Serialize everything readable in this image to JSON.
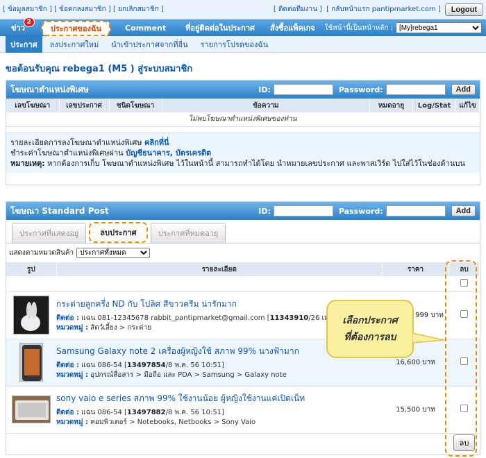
{
  "topbar": {
    "links": [
      "[ ข้อมูลสมาชิก ]",
      "[ ข้อตกลงสมาชิก ]",
      "[ ยกเลิกสมาชิก ]"
    ],
    "contact": "[ ติดต่อทีมงาน ]",
    "home": "[ กลับหน้าแรก pantipmarket.com ]",
    "logout": "Logout"
  },
  "nav": {
    "items": [
      {
        "label": "ข่าว",
        "badge": "2"
      },
      {
        "label": "ประกาศของฉัน"
      },
      {
        "label": "Comment"
      },
      {
        "label": "ที่อยู่ติดต่อในประกาศ"
      },
      {
        "label": "สั่งซื้อแพ็คเกจ"
      }
    ],
    "home_label": "ใช้หน้านี้เป็นหน้าหลัก :",
    "home_select": "[My]rebega1"
  },
  "subnav": [
    "ประกาศ",
    "ลงประกาศใหม่",
    "นำเข้าประกาศจากที่อื่น",
    "รายการโปรดของฉัน"
  ],
  "welcome": "ขอต้อนรับคุณ rebega1     (M5       ) สู่ระบบสมาชิก",
  "special": {
    "title": "โฆษณาตำแหน่งพิเศษ",
    "id_label": "ID:",
    "pw_label": "Password:",
    "add": "Add",
    "headers": [
      "เลขโฆษณา",
      "เลขประกาศ",
      "ชนิดโฆษณา",
      "ข้อความ",
      "หมดอายุ",
      "Log/Stat",
      "แก้ไข"
    ],
    "empty": "ไม่พบโฆษณาตำแหน่งพิเศษของท่าน",
    "info1_text": "รายละเอียดการลงโฆษณาตำแหน่งพิเศษ ",
    "info1_link": "คลิกที่นี่",
    "info2_text": "ชำระค่าโฆษณาตำแหน่งพิเศษผ่าน ",
    "info2_link": "บัญชีธนาคาร, บัตรเครดิต",
    "info3_label": "หมายเหตุ:",
    "info3_text": " หากต้องการเก็บ โฆษณาตำแหน่งพิเศษ ไว้ในหน้านี้ สามารถทำได้โดย นำหมายเลขประกาศ และพาสเวิร์ด ไปใส่ไว้ในช่องด้านบน"
  },
  "standard": {
    "title": "โฆษณา Standard Post",
    "id_label": "ID:",
    "pw_label": "Password:",
    "add": "Add",
    "tabs": [
      "ประกาศที่แสดงอยู่",
      "ลบประกาศ",
      "ประกาศที่หมดอายุ"
    ],
    "filter_label": "แสดงตามหมวดสินค้า",
    "filter_value": "ประกาศทั้งหมด",
    "headers": [
      "รูป",
      "รายละเอียด",
      "ราคา",
      "ลบ"
    ],
    "rows": [
      {
        "title": "กระต่ายลูกครึ่ง ND กับ โปลิศ สีขาวครีม น่ารักมาก",
        "contact_label": "ติดต่อ :",
        "contact": " แฉน 081-12345678 rabbit_pantipmarket@gmail.com [",
        "id": "11343910",
        "date": "/26 เม.ย. 5",
        "cat_label": "หมวดหมู่ :",
        "cat": " สัตว์เลี้ยง > กระต่าย",
        "price": "999 บาท"
      },
      {
        "title": "Samsung Galaxy note 2 เครื่องผู้หญิงใช้ สภาพ 99% นางฟ้ามาก",
        "contact_label": "ติดต่อ :",
        "contact": " แฉน 086-54       [",
        "id": "13497854",
        "date": "/8 พ.ค. 56 10:51]",
        "cat_label": "หมวดหมู่ :",
        "cat": " อุปกรณ์สื่อสาร > มือถือ และ PDA > Samsung > Galaxy note",
        "price": "16,600 บาท"
      },
      {
        "title": "sony vaio e series สภาพ 99% ใช้งานน้อย ผู้หญิงใช้งานแค่เปิดเน็ท",
        "contact_label": "ติดต่อ :",
        "contact": " แฉน 086-54       [",
        "id": "13497882",
        "date": "/8 พ.ค. 56 10:51]",
        "cat_label": "หมวดหมู่ :",
        "cat": " คอมพิวเตอร์ > Notebooks, Netbooks > Sony Vaio",
        "price": "15,500 บาท"
      }
    ],
    "delete_button": "ลบ"
  },
  "tooltip": {
    "line1": "เลือกประกาศ",
    "line2": "ที่ต้องการลบ"
  },
  "colors": {
    "accent": "#2d7fc6",
    "callout": "#f08a00",
    "link": "#0b55b7"
  }
}
